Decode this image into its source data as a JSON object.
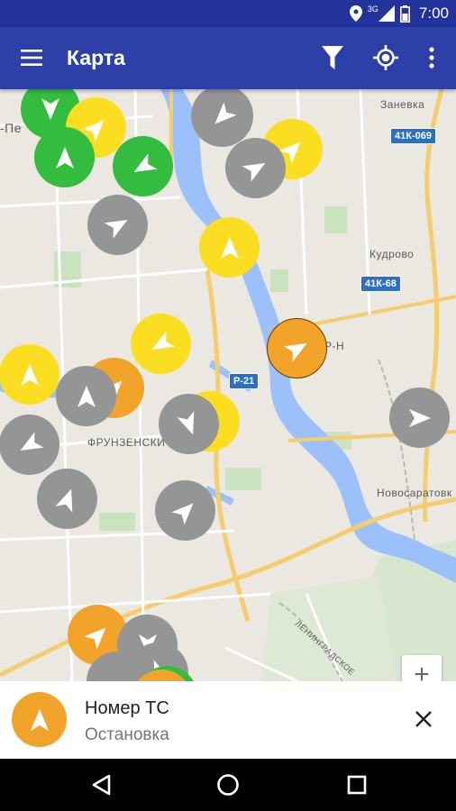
{
  "status_bar": {
    "time": "7:00",
    "network": "3G"
  },
  "app_bar": {
    "title": "Карта"
  },
  "map": {
    "labels": {
      "zanevka": "Заневка",
      "kudrovo": "Кудрово",
      "frunzensky": "ФРУНЗЕНСКИ",
      "novosaratovka": "Новосаратовк",
      "rn": "Р-Н",
      "pe": "-Пе",
      "leningradskoe": "ЛЕНИНГРАДСКОЕ"
    },
    "road_badges": {
      "r1": "41К-069",
      "r2": "41К-68",
      "r3": "Р-21"
    }
  },
  "colors": {
    "yellow": "#fbdd22",
    "green": "#33bc3d",
    "gray": "#959595",
    "orange": "#f2a32a",
    "appbar": "#2d40a8",
    "statusbar": "#22339b"
  },
  "bottom_sheet": {
    "title": "Номер ТС",
    "subtitle": "Остановка"
  },
  "zoom": {
    "plus": "+"
  }
}
